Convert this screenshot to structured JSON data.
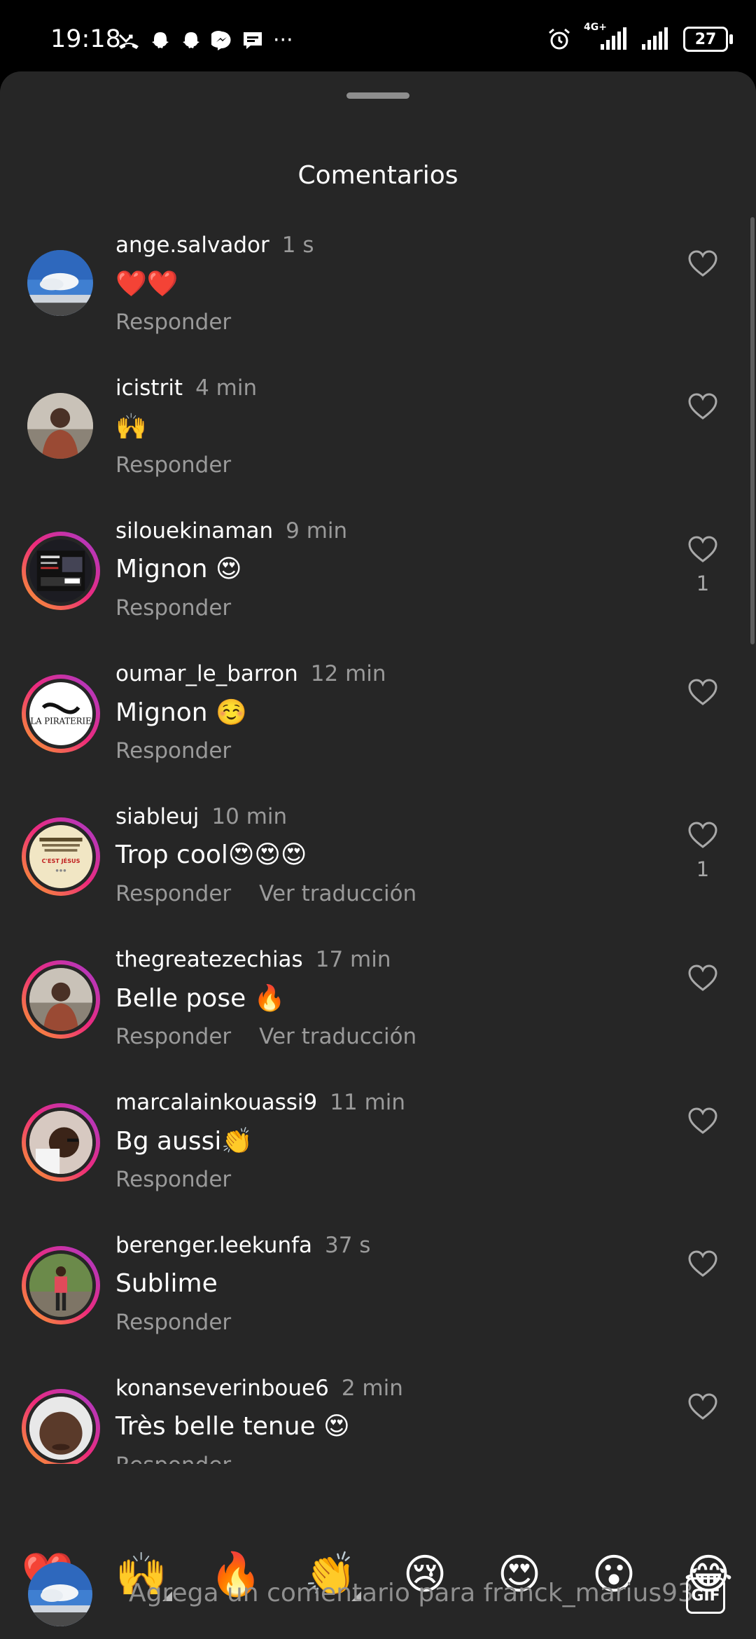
{
  "status_bar": {
    "time": "19:18",
    "left_icons": [
      "missed-call-icon",
      "snapchat-icon",
      "snapchat-icon",
      "messenger-icon",
      "message-icon",
      "more-icon"
    ],
    "more": "···",
    "network": "4G+",
    "battery": "27"
  },
  "sheet": {
    "title": "Comentarios"
  },
  "comments": [
    {
      "user": "ange.salvador",
      "time": "1 s",
      "text": "❤️❤️",
      "reply": "Responder",
      "translate": "",
      "likes": "",
      "ring": false,
      "avatar": "sky-photo"
    },
    {
      "user": "icistrit",
      "time": "4 min",
      "text": "🙌",
      "reply": "Responder",
      "translate": "",
      "likes": "",
      "ring": false,
      "avatar": "person-photo"
    },
    {
      "user": "silouekinaman",
      "time": "9 min",
      "text": "Mignon 😍",
      "reply": "Responder",
      "translate": "",
      "likes": "1",
      "ring": true,
      "avatar": "flyer"
    },
    {
      "user": "oumar_le_barron",
      "time": "12 min",
      "text": "Mignon ☺️",
      "reply": "Responder",
      "translate": "",
      "likes": "",
      "ring": true,
      "avatar": "la-piraterie-logo",
      "avatar_text": "LA PIRATERIE"
    },
    {
      "user": "siableuj",
      "time": "10 min",
      "text": "Trop cool😍😍😍",
      "reply": "Responder",
      "translate": "Ver traducción",
      "likes": "1",
      "ring": true,
      "avatar": "jesus-poster",
      "avatar_text": "C'EST JÉSUS"
    },
    {
      "user": "thegreatezechias",
      "time": "17 min",
      "text": "Belle pose 🔥",
      "reply": "Responder",
      "translate": "Ver traducción",
      "likes": "",
      "ring": true,
      "avatar": "person-photo"
    },
    {
      "user": "marcalainkouassi9",
      "time": "11 min",
      "text": "Bg aussi👏",
      "reply": "Responder",
      "translate": "",
      "likes": "",
      "ring": true,
      "avatar": "selfie-photo"
    },
    {
      "user": "berenger.leekunfa",
      "time": "37 s",
      "text": "Sublime",
      "reply": "Responder",
      "translate": "",
      "likes": "",
      "ring": true,
      "avatar": "outdoor-photo"
    },
    {
      "user": "konanseverinboue6",
      "time": "2 min",
      "text": "Très belle tenue 😍",
      "reply": "Responder",
      "translate": "",
      "likes": "",
      "ring": true,
      "avatar": "face-photo"
    }
  ],
  "reactions": [
    {
      "emoji": "❤️",
      "name": "heart",
      "more": false
    },
    {
      "emoji": "🙌",
      "name": "raised-hands",
      "more": true
    },
    {
      "emoji": "🔥",
      "name": "fire",
      "more": false
    },
    {
      "emoji": "👏",
      "name": "clap",
      "more": true
    },
    {
      "emoji": "😢",
      "name": "crying",
      "more": false
    },
    {
      "emoji": "😍",
      "name": "heart-eyes",
      "more": false
    },
    {
      "emoji": "😮",
      "name": "surprised",
      "more": false
    },
    {
      "emoji": "😂",
      "name": "laughing",
      "more": false
    }
  ],
  "input": {
    "placeholder": "Agrega un comentario para franck_marius93",
    "gif_label": "GIF"
  },
  "colors": {
    "sheet_bg": "#262626",
    "secondary_text": "#9a9a9a",
    "ring_gradient": [
      "#f9a42a",
      "#ee2a7b",
      "#a23bd1"
    ]
  }
}
